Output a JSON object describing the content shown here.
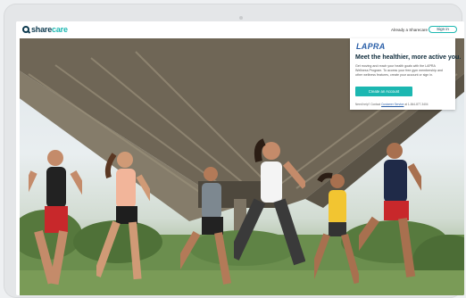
{
  "header": {
    "logo_left": "share",
    "logo_right": "care",
    "already_member": "Already a Sharecare User?",
    "sign_in": "Sign in"
  },
  "card": {
    "brand": "LAPRA",
    "title": "Meet the healthier, more active you.",
    "body": "Get moving and reach your health goals with the LAPRA Wellness Program. To access your free gym membership and other wellness features, create your account or sign in.",
    "cta": "Create an Account",
    "help_prefix": "Need help? Contact",
    "help_link": "Customer Service",
    "help_suffix": "at 1-844-877-3404"
  },
  "colors": {
    "accent": "#1cb7b1",
    "brand_navy": "#0d3a4f",
    "brand_blue": "#2a5fa8"
  },
  "icons": {
    "logo": "magnifier-logo-icon"
  }
}
